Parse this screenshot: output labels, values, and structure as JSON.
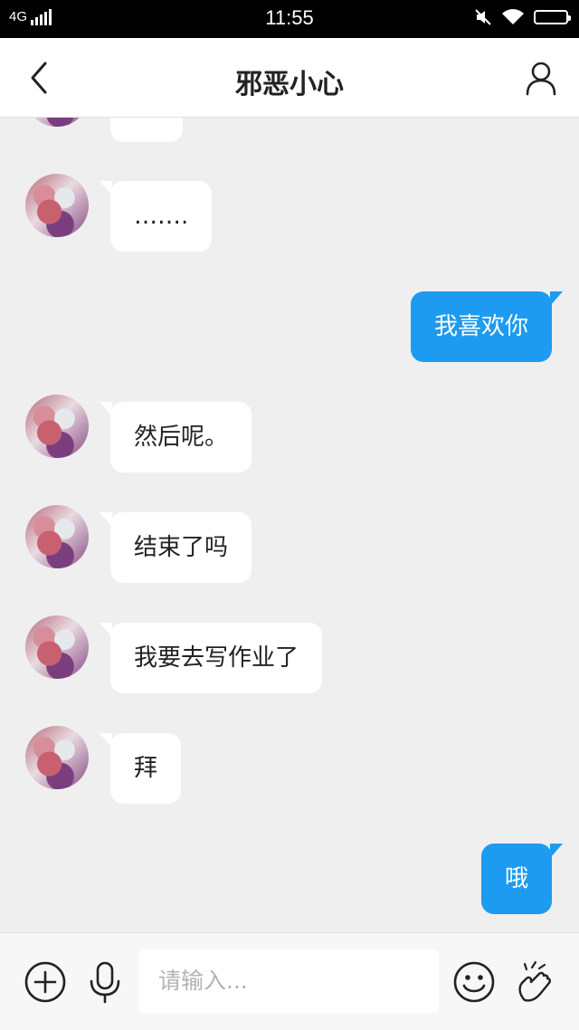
{
  "status_bar": {
    "network": "4G",
    "time": "11:55"
  },
  "header": {
    "title": "邪恶小心"
  },
  "messages": [
    {
      "side": "in",
      "text": "……."
    },
    {
      "side": "out",
      "text": "我喜欢你"
    },
    {
      "side": "in",
      "text": "然后呢。"
    },
    {
      "side": "in",
      "text": "结束了吗"
    },
    {
      "side": "in",
      "text": "我要去写作业了"
    },
    {
      "side": "in",
      "text": "拜"
    },
    {
      "side": "out",
      "text": "哦"
    }
  ],
  "input": {
    "placeholder": "请输入..."
  },
  "colors": {
    "accent": "#1d9bf0",
    "background": "#efefef"
  },
  "icons": [
    "back-icon",
    "profile-icon",
    "add-icon",
    "microphone-icon",
    "emoji-icon",
    "gesture-icon"
  ]
}
